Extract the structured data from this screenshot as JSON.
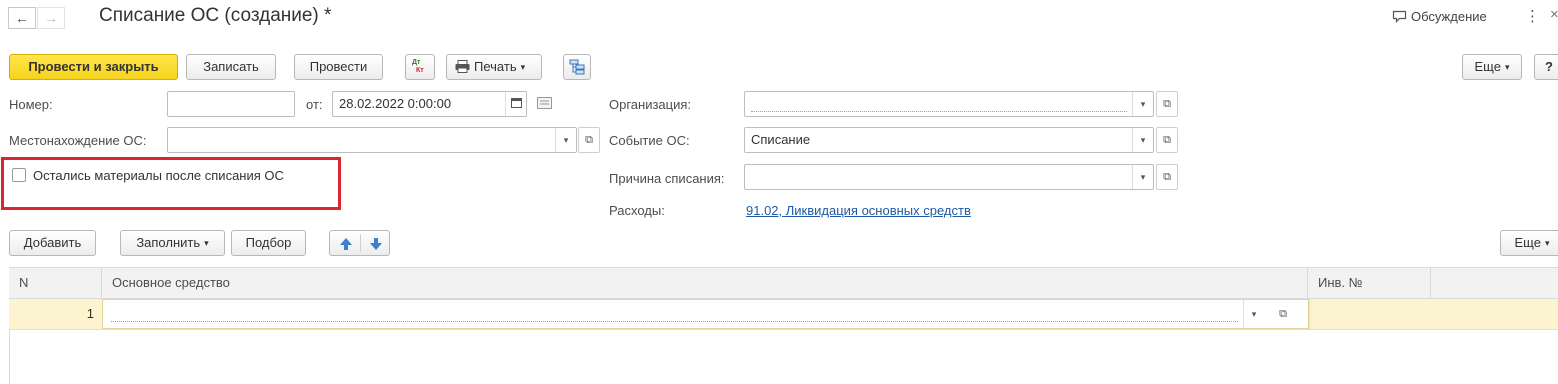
{
  "header": {
    "title": "Списание ОС (создание) *",
    "back_glyph": "←",
    "forward_glyph": "→",
    "discussion_label": "Обсуждение",
    "more_glyph": "⋮",
    "close_glyph": "×"
  },
  "toolbar": {
    "post_close_label": "Провести и закрыть",
    "save_label": "Записать",
    "post_label": "Провести",
    "dtkt_top": "Дт",
    "dtkt_bottom": "Кт",
    "print_label": "Печать",
    "more_label": "Еще",
    "help_label": "?"
  },
  "form": {
    "number_label": "Номер:",
    "number_value": "",
    "from_label": "от:",
    "date_value": "28.02.2022  0:00:00",
    "org_label": "Организация:",
    "org_value": "",
    "location_label": "Местонахождение ОС:",
    "location_value": "",
    "event_label": "Событие ОС:",
    "event_value": "Списание",
    "reason_label": "Причина списания:",
    "reason_value": "",
    "checkbox_label": "Остались материалы после списания ОС",
    "checkbox_checked": false,
    "expenses_label": "Расходы:",
    "expenses_link": "91.02, Ликвидация основных средств"
  },
  "table_toolbar": {
    "add_label": "Добавить",
    "fill_label": "Заполнить",
    "pick_label": "Подбор",
    "more_label": "Еще"
  },
  "table": {
    "columns": [
      "N",
      "Основное средство",
      "Инв. №"
    ],
    "rows": [
      {
        "n": "1",
        "asset": "",
        "inv": ""
      }
    ]
  },
  "colors": {
    "primary_button": "#f7d31c",
    "highlight_border": "#d9262f",
    "link": "#1f5aa6",
    "selected_row": "#fbf4cf"
  },
  "icons": [
    "arrow-left-icon",
    "arrow-right-icon",
    "discussion-icon",
    "dtkt-icon",
    "printer-icon",
    "structure-icon",
    "calendar-icon",
    "comment-icon",
    "open-icon",
    "arrow-up-icon",
    "arrow-down-icon"
  ]
}
